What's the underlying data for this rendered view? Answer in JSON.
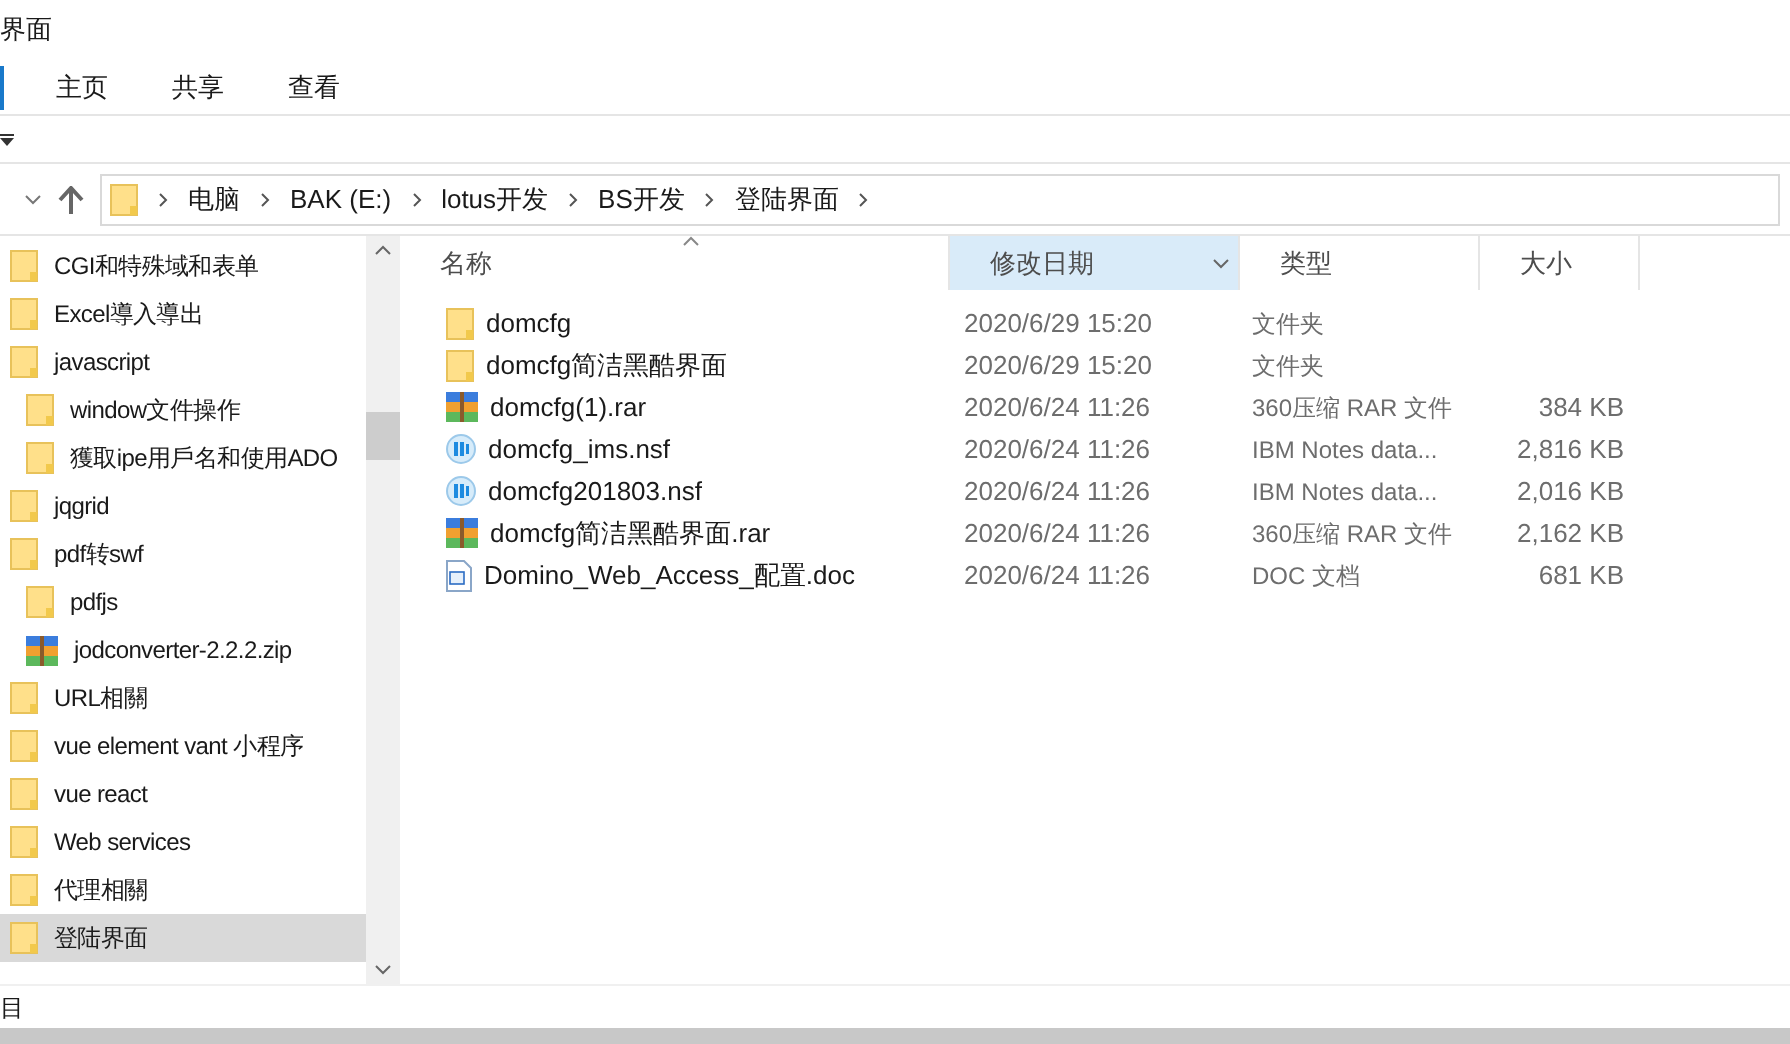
{
  "window": {
    "title": "界面"
  },
  "ribbon_tabs": [
    {
      "label": "主页",
      "selected": false
    },
    {
      "label": "共享",
      "selected": false
    },
    {
      "label": "查看",
      "selected": false
    }
  ],
  "breadcrumb": [
    "电脑",
    "BAK (E:)",
    "lotus开发",
    "BS开发",
    "登陆界面"
  ],
  "sidebar": {
    "items": [
      {
        "label": "CGI和特殊域和表单",
        "kind": "folder",
        "selected": false
      },
      {
        "label": "Excel導入導出",
        "kind": "folder",
        "selected": false
      },
      {
        "label": "javascript",
        "kind": "folder",
        "selected": false,
        "children": [
          {
            "label": "window文件操作",
            "kind": "folder",
            "selected": false
          },
          {
            "label": "獲取ipe用戶名和使用ADO",
            "kind": "folder",
            "selected": false
          }
        ]
      },
      {
        "label": "jqgrid",
        "kind": "folder",
        "selected": false
      },
      {
        "label": "pdf转swf",
        "kind": "folder",
        "selected": false,
        "children": [
          {
            "label": "pdfjs",
            "kind": "folder",
            "selected": false
          },
          {
            "label": "jodconverter-2.2.2.zip",
            "kind": "archive",
            "selected": false
          }
        ]
      },
      {
        "label": "URL相關",
        "kind": "folder",
        "selected": false
      },
      {
        "label": "vue element vant 小程序",
        "kind": "folder",
        "selected": false
      },
      {
        "label": "vue react",
        "kind": "folder",
        "selected": false
      },
      {
        "label": "Web services",
        "kind": "folder",
        "selected": false
      },
      {
        "label": "代理相關",
        "kind": "folder",
        "selected": false
      },
      {
        "label": "登陆界面",
        "kind": "folder",
        "selected": true
      }
    ]
  },
  "table": {
    "columns": [
      {
        "label": "名称",
        "selected": false
      },
      {
        "label": "修改日期",
        "selected": true
      },
      {
        "label": "类型",
        "selected": false
      },
      {
        "label": "大小",
        "selected": false
      }
    ],
    "rows": [
      {
        "name": "domcfg",
        "date": "2020/6/29 15:20",
        "type": "文件夹",
        "kind": "folder"
      },
      {
        "name": "domcfg简洁黑酷界面",
        "date": "2020/6/29 15:20",
        "type": "文件夹",
        "kind": "folder"
      },
      {
        "name": "domcfg(1).rar",
        "date": "2020/6/24 11:26",
        "type": "360压缩 RAR 文件",
        "size": "384 KB",
        "kind": "archive"
      },
      {
        "name": "domcfg_ims.nsf",
        "date": "2020/6/24 11:26",
        "type": "IBM Notes data...",
        "size": "2,816 KB",
        "kind": "database"
      },
      {
        "name": "domcfg201803.nsf",
        "date": "2020/6/24 11:26",
        "type": "IBM Notes data...",
        "size": "2,016 KB",
        "kind": "database"
      },
      {
        "name": "domcfg简洁黑酷界面.rar",
        "date": "2020/6/24 11:26",
        "type": "360压缩 RAR 文件",
        "size": "2,162 KB",
        "kind": "archive"
      },
      {
        "name": "Domino_Web_Access_配置.doc",
        "date": "2020/6/24 11:26",
        "type": "DOC 文档",
        "size": "681 KB",
        "kind": "document"
      }
    ]
  },
  "status_bar": {
    "text": "目"
  }
}
